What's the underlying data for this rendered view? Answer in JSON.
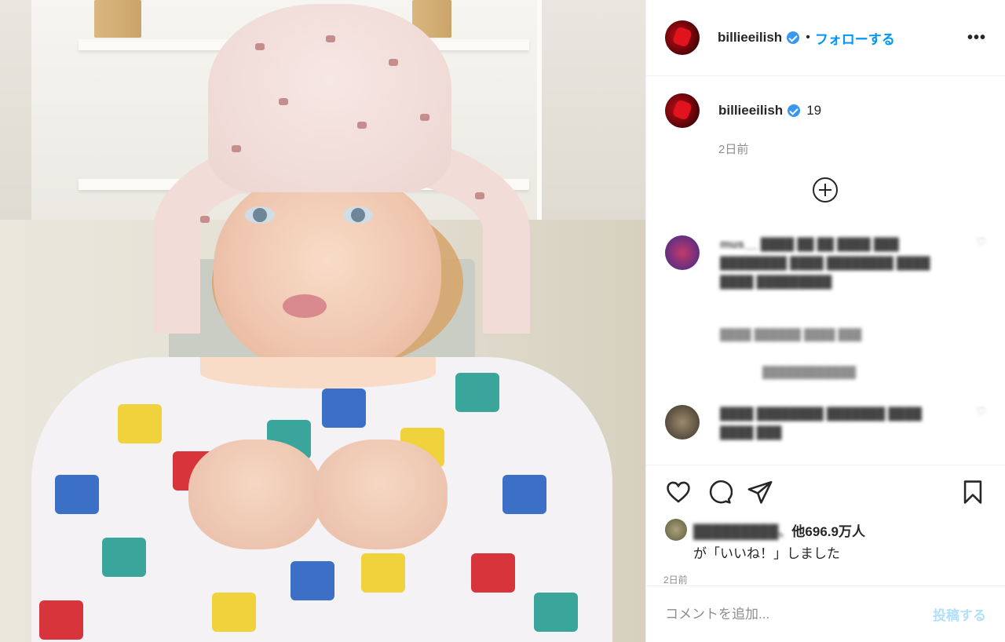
{
  "header": {
    "username": "billieeilish",
    "separator": "•",
    "follow_label": "フォローする",
    "more_label": "•••"
  },
  "caption": {
    "username": "billieeilish",
    "text": "19",
    "time": "2日前"
  },
  "comments": [
    {
      "username": "mus__",
      "text": "████ ██ ██ ████ ███ ████████ ████ ████████ ████ ████ █████████",
      "meta": "████ ██████ ████ ███"
    },
    {
      "username": "████",
      "text": "████████ ███████ ████ ████ ███",
      "meta": ""
    }
  ],
  "replies_label": "████████████",
  "actions": {
    "likes_prefix": "█████████、",
    "likes_count": "他696.9万人",
    "likes_suffix": "が「いいね！」しました",
    "time": "2日前"
  },
  "add_comment": {
    "placeholder": "コメントを追加...",
    "post_label": "投稿する"
  },
  "colors": {
    "accent": "#0095f6",
    "post_disabled": "#b2dffc",
    "verified": "#3897f0"
  }
}
